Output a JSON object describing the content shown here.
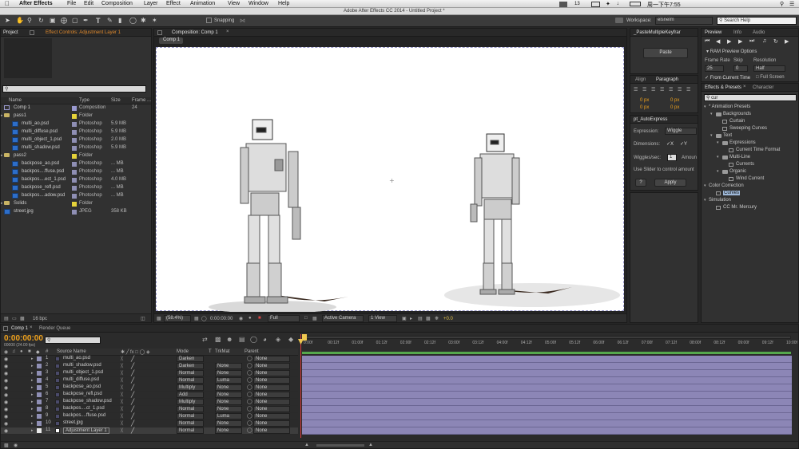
{
  "menubar": {
    "app": "After Effects",
    "file": "File",
    "edit": "Edit",
    "composition": "Composition",
    "layer": "Layer",
    "effect": "Effect",
    "animation": "Animation",
    "view": "View",
    "window": "Window",
    "help": "Help",
    "title": "Adobe After Effects CC 2014 - Untitled Project *",
    "status": "周一下午7:55",
    "mail_count": "13"
  },
  "toolbar": {
    "snapping": "Snapping",
    "workspace_label": "Workspace:",
    "workspace_value": "eisneim",
    "search_help": "Search Help"
  },
  "project": {
    "tab_project": "Project",
    "tab_effect_controls": "Effect Controls: Adjustment Layer 1",
    "comp_name": "Comp 1",
    "columns": [
      "Name",
      "Type",
      "Size",
      "Frame ..."
    ],
    "bpc": "16 bpc",
    "items": [
      {
        "name": "Comp 1",
        "type": "Composition",
        "size": "",
        "frame": "24",
        "color": "#9a9ad0",
        "kind": "comp",
        "indent": 0
      },
      {
        "name": "pass1",
        "type": "Folder",
        "size": "",
        "frame": "",
        "color": "#e6d33a",
        "kind": "folder",
        "indent": 0
      },
      {
        "name": "multi_ao.psd",
        "type": "Photoshop",
        "size": "5.9 MB",
        "frame": "",
        "color": "#8f8fb4",
        "kind": "psd",
        "indent": 1
      },
      {
        "name": "multi_diffuse.psd",
        "type": "Photoshop",
        "size": "5.9 MB",
        "frame": "",
        "color": "#8f8fb4",
        "kind": "psd",
        "indent": 1
      },
      {
        "name": "multi_object_1.psd",
        "type": "Photoshop",
        "size": "2.0 MB",
        "frame": "",
        "color": "#8f8fb4",
        "kind": "psd",
        "indent": 1
      },
      {
        "name": "multi_shadow.psd",
        "type": "Photoshop",
        "size": "5.9 MB",
        "frame": "",
        "color": "#8f8fb4",
        "kind": "psd",
        "indent": 1
      },
      {
        "name": "pass2",
        "type": "Folder",
        "size": "",
        "frame": "",
        "color": "#e6d33a",
        "kind": "folder",
        "indent": 0
      },
      {
        "name": "backpose_ao.psd",
        "type": "Photoshop",
        "size": "... MB",
        "frame": "",
        "color": "#8f8fb4",
        "kind": "psd",
        "indent": 1
      },
      {
        "name": "backpos....ffuse.psd",
        "type": "Photoshop",
        "size": "... MB",
        "frame": "",
        "color": "#8f8fb4",
        "kind": "psd",
        "indent": 1
      },
      {
        "name": "backpos....ect_1.psd",
        "type": "Photoshop",
        "size": "4.0 MB",
        "frame": "",
        "color": "#8f8fb4",
        "kind": "psd",
        "indent": 1
      },
      {
        "name": "backpose_refl.psd",
        "type": "Photoshop",
        "size": "... MB",
        "frame": "",
        "color": "#8f8fb4",
        "kind": "psd",
        "indent": 1
      },
      {
        "name": "backpos....adow.psd",
        "type": "Photoshop",
        "size": "... MB",
        "frame": "",
        "color": "#8f8fb4",
        "kind": "psd",
        "indent": 1
      },
      {
        "name": "Solids",
        "type": "Folder",
        "size": "",
        "frame": "",
        "color": "#e6d33a",
        "kind": "folder",
        "indent": 0
      },
      {
        "name": "street.jpg",
        "type": "JPEG",
        "size": "358 KB",
        "frame": "",
        "color": "#8f8fb4",
        "kind": "jpg",
        "indent": 0
      }
    ]
  },
  "composition": {
    "tab": "Composition: Comp 1",
    "subtab": "Comp 1",
    "zoom": "(58.4%)",
    "timecode": "0:00:00:00",
    "resolution": "Full",
    "camera": "Active Camera",
    "view": "1 View",
    "exposure": "+0.0"
  },
  "paste_panel": {
    "tab": "_PasteMultipleKeyfrar",
    "button": "Paste"
  },
  "align_panel": {
    "tab_align": "Align",
    "tab_paragraph": "Paragraph",
    "px": [
      "0 px",
      "0 px",
      "0 px",
      "0 px",
      "0 px"
    ]
  },
  "autoexpress": {
    "tab": "pt_AutoExpress",
    "expression_label": "Expression:",
    "expression_value": "Wiggle",
    "dimensions_label": "Dimensions:",
    "dim_x": "X",
    "dim_y": "Y",
    "wiggles_label": "Wiggles/sec:",
    "wiggles_value": "1",
    "amount_label": "Amoun",
    "hint": "Use Slider to control amount",
    "help": "?",
    "apply": "Apply"
  },
  "preview": {
    "tab_preview": "Preview",
    "tab_info": "Info",
    "tab_audio": "Audio",
    "ram": "RAM Preview Options",
    "frame_rate_label": "Frame Rate",
    "skip_label": "Skip",
    "resolution_label": "Resolution",
    "frame_rate": "25",
    "skip": "0",
    "resolution": "Half",
    "from_current": "From Current Time",
    "full_screen": "Full Screen"
  },
  "effects": {
    "tab_effects": "Effects & Presets",
    "tab_character": "Character",
    "search": "cur",
    "tree": [
      {
        "label": "* Animation Presets",
        "depth": 0,
        "kind": "group"
      },
      {
        "label": "Backgrounds",
        "depth": 1,
        "kind": "folder"
      },
      {
        "label": "Curtain",
        "depth": 2,
        "kind": "item"
      },
      {
        "label": "Sweeping Curves",
        "depth": 2,
        "kind": "item"
      },
      {
        "label": "Text",
        "depth": 1,
        "kind": "folder"
      },
      {
        "label": "Expressions",
        "depth": 2,
        "kind": "folder"
      },
      {
        "label": "Current Time Format",
        "depth": 3,
        "kind": "item"
      },
      {
        "label": "Multi-Line",
        "depth": 2,
        "kind": "folder"
      },
      {
        "label": "Currents",
        "depth": 3,
        "kind": "item"
      },
      {
        "label": "Organic",
        "depth": 2,
        "kind": "folder"
      },
      {
        "label": "Wind Current",
        "depth": 3,
        "kind": "item"
      },
      {
        "label": "Color Correction",
        "depth": 0,
        "kind": "group"
      },
      {
        "label": "Curves",
        "depth": 1,
        "kind": "effect",
        "selected": true
      },
      {
        "label": "Simulation",
        "depth": 0,
        "kind": "group"
      },
      {
        "label": "CC Mr. Mercury",
        "depth": 1,
        "kind": "effect"
      }
    ]
  },
  "timeline": {
    "tab_comp": "Comp 1",
    "tab_render": "Render Queue",
    "timecode": "0:00:00:00",
    "frames": "00000 (24.00 fps)",
    "search_placeholder": "",
    "headers": {
      "num": "#",
      "source": "Source Name",
      "mode": "Mode",
      "t": "T",
      "trkmat": "TrkMat",
      "parent": "Parent"
    },
    "ruler": [
      "0:00f",
      "00:12f",
      "01:00f",
      "01:12f",
      "02:00f",
      "02:12f",
      "03:00f",
      "03:12f",
      "04:00f",
      "04:12f",
      "05:00f",
      "05:12f",
      "06:00f",
      "06:12f",
      "07:00f",
      "07:12f",
      "08:00f",
      "08:12f",
      "09:00f",
      "09:12f",
      "10:00f"
    ],
    "layers": [
      {
        "num": "1",
        "name": "multi_ao.psd",
        "mode": "Darken",
        "trkmat": "",
        "parent": "None",
        "color": "#8f8fb4"
      },
      {
        "num": "2",
        "name": "multi_shadow.psd",
        "mode": "Darken",
        "trkmat": "None",
        "parent": "None",
        "color": "#8f8fb4"
      },
      {
        "num": "3",
        "name": "multi_object_1.psd",
        "mode": "Normal",
        "trkmat": "None",
        "parent": "None",
        "color": "#8f8fb4"
      },
      {
        "num": "4",
        "name": "multi_diffuse.psd",
        "mode": "Normal",
        "trkmat": "Luma",
        "parent": "None",
        "color": "#8f8fb4"
      },
      {
        "num": "5",
        "name": "backpose_ao.psd",
        "mode": "Multiply",
        "trkmat": "None",
        "parent": "None",
        "color": "#8f8fb4"
      },
      {
        "num": "6",
        "name": "backpose_refl.psd",
        "mode": "Add",
        "trkmat": "None",
        "parent": "None",
        "color": "#8f8fb4"
      },
      {
        "num": "7",
        "name": "backpose_shadow.psd",
        "mode": "Multiply",
        "trkmat": "None",
        "parent": "None",
        "color": "#8f8fb4"
      },
      {
        "num": "8",
        "name": "backpos....ct_1.psd",
        "mode": "Normal",
        "trkmat": "None",
        "parent": "None",
        "color": "#8f8fb4"
      },
      {
        "num": "9",
        "name": "backpos....ffuse.psd",
        "mode": "Normal",
        "trkmat": "Luma",
        "parent": "None",
        "color": "#8f8fb4"
      },
      {
        "num": "10",
        "name": "street.jpg",
        "mode": "Normal",
        "trkmat": "None",
        "parent": "None",
        "color": "#8f8fb4"
      },
      {
        "num": "11",
        "name": "Adjustment Layer 1",
        "mode": "Normal",
        "trkmat": "None",
        "parent": "None",
        "color": "#e8e8e8"
      }
    ]
  },
  "colors": {
    "accent_blue": "#5aa2ea",
    "timecode_orange": "#f0a21d",
    "layer_bar": "#8c86b6",
    "folder": "#e6d33a"
  }
}
